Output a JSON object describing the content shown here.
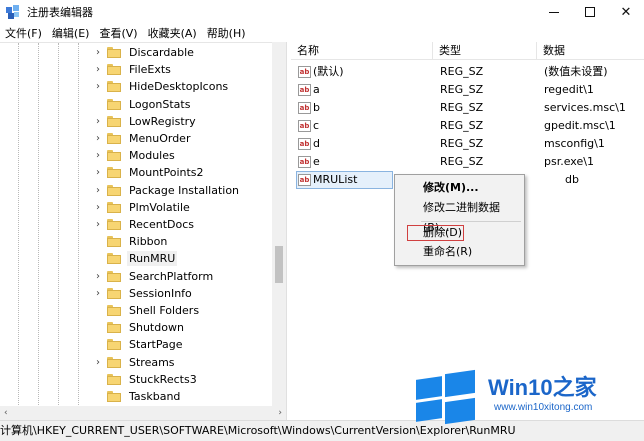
{
  "window": {
    "title": "注册表编辑器",
    "minimize_icon": "minimize-icon",
    "maximize_icon": "maximize-icon",
    "close_label": "✕"
  },
  "menu": {
    "items": [
      "文件(F)",
      "编辑(E)",
      "查看(V)",
      "收藏夹(A)",
      "帮助(H)"
    ]
  },
  "tree": {
    "items": [
      {
        "label": "Discardable",
        "expander": "›"
      },
      {
        "label": "FileExts",
        "expander": "›"
      },
      {
        "label": "HideDesktopIcons",
        "expander": "›"
      },
      {
        "label": "LogonStats",
        "expander": ""
      },
      {
        "label": "LowRegistry",
        "expander": "›"
      },
      {
        "label": "MenuOrder",
        "expander": "›"
      },
      {
        "label": "Modules",
        "expander": "›"
      },
      {
        "label": "MountPoints2",
        "expander": "›"
      },
      {
        "label": "Package Installation",
        "expander": "›"
      },
      {
        "label": "PlmVolatile",
        "expander": "›"
      },
      {
        "label": "RecentDocs",
        "expander": "›"
      },
      {
        "label": "Ribbon",
        "expander": ""
      },
      {
        "label": "RunMRU",
        "expander": "",
        "selected": true
      },
      {
        "label": "SearchPlatform",
        "expander": "›"
      },
      {
        "label": "SessionInfo",
        "expander": "›"
      },
      {
        "label": "Shell Folders",
        "expander": ""
      },
      {
        "label": "Shutdown",
        "expander": ""
      },
      {
        "label": "StartPage",
        "expander": ""
      },
      {
        "label": "Streams",
        "expander": "›"
      },
      {
        "label": "StuckRects3",
        "expander": ""
      },
      {
        "label": "Taskband",
        "expander": ""
      }
    ],
    "scroll_left": "‹",
    "scroll_right": "›"
  },
  "list": {
    "headers": {
      "name": "名称",
      "type": "类型",
      "data": "数据"
    },
    "rows": [
      {
        "name": "(默认)",
        "type": "REG_SZ",
        "data": "(数值未设置)"
      },
      {
        "name": "a",
        "type": "REG_SZ",
        "data": "regedit\\1"
      },
      {
        "name": "b",
        "type": "REG_SZ",
        "data": "services.msc\\1"
      },
      {
        "name": "c",
        "type": "REG_SZ",
        "data": "gpedit.msc\\1"
      },
      {
        "name": "d",
        "type": "REG_SZ",
        "data": "msconfig\\1"
      },
      {
        "name": "e",
        "type": "REG_SZ",
        "data": "psr.exe\\1"
      },
      {
        "name": "MRUList",
        "type": "",
        "data": "db",
        "selected": true
      }
    ],
    "value_icon_text": "ab"
  },
  "context_menu": {
    "modify": "修改(M)...",
    "modify_binary": "修改二进制数据(B)...",
    "delete": "删除(D)",
    "rename": "重命名(R)"
  },
  "statusbar": {
    "path": "计算机\\HKEY_CURRENT_USER\\SOFTWARE\\Microsoft\\Windows\\CurrentVersion\\Explorer\\RunMRU"
  },
  "watermark": {
    "brand": "Win10之家",
    "url": "www.win10xitong.com",
    "logo_icon": "windows-logo-icon",
    "brand_color": "#1b66c9"
  }
}
